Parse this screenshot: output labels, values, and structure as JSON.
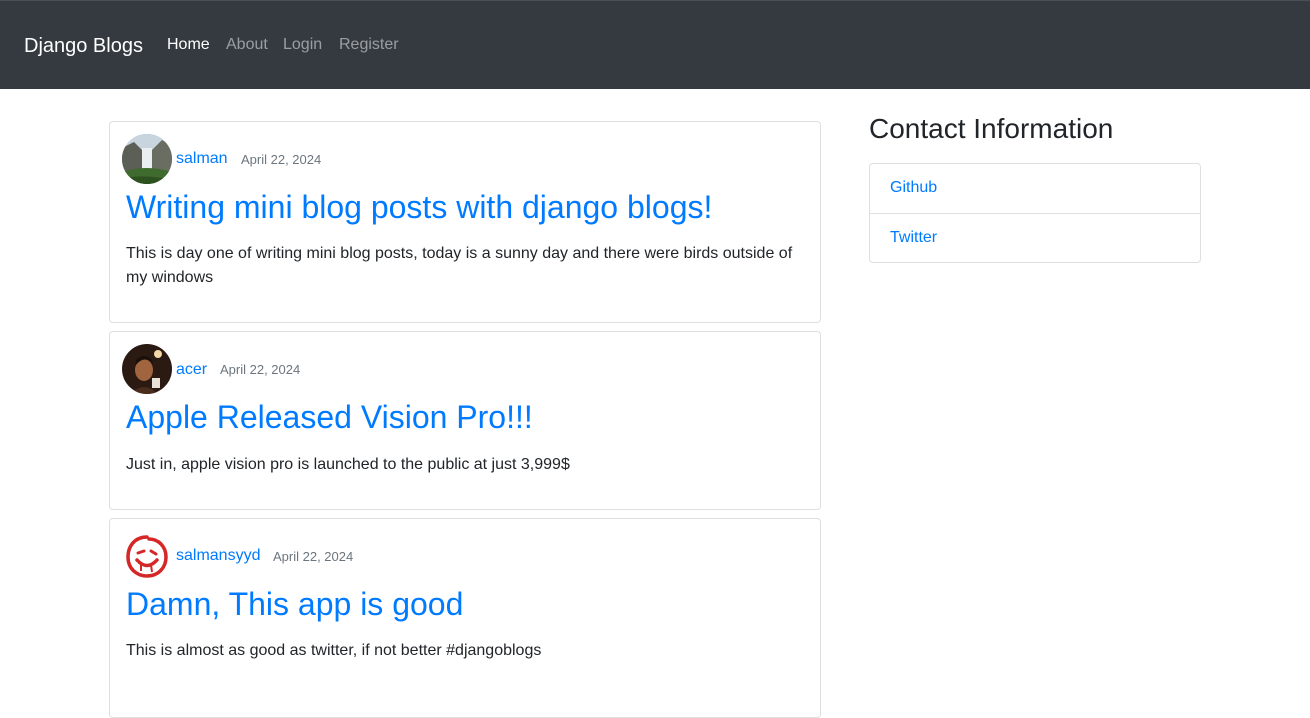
{
  "navbar": {
    "brand": "Django Blogs",
    "links": [
      {
        "label": "Home",
        "active": true
      },
      {
        "label": "About",
        "active": false
      },
      {
        "label": "Login",
        "active": false
      },
      {
        "label": "Register",
        "active": false
      }
    ]
  },
  "posts": [
    {
      "author": "salman",
      "date": "April 22, 2024",
      "title": "Writing mini blog posts with django blogs!",
      "content": "This is day one of writing mini blog posts, today is a sunny day and there were birds outside of my windows",
      "avatar": "waterfall-landscape-photo"
    },
    {
      "author": "acer",
      "date": "April 22, 2024",
      "title": "Apple Released Vision Pro!!!",
      "content": "Just in, apple vision pro is launched to the public at just 3,999$",
      "avatar": "person-portrait-photo"
    },
    {
      "author": "salmansyyd",
      "date": "April 22, 2024",
      "title": "Damn, This app is good",
      "content": "This is almost as good as twitter, if not better #djangoblogs",
      "avatar": "red-smiley-drawing"
    }
  ],
  "sidebar": {
    "title": "Contact Information",
    "links": [
      {
        "label": "Github"
      },
      {
        "label": "Twitter"
      }
    ]
  },
  "colors": {
    "navbar_bg": "#343a40",
    "link": "#007bff",
    "muted": "#6c757d"
  }
}
